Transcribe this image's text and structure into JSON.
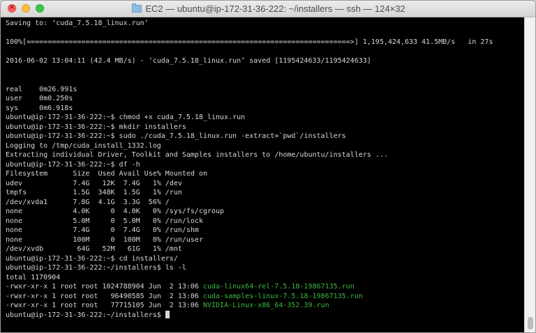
{
  "window": {
    "title": "EC2 — ubuntu@ip-172-31-36-222: ~/installers — ssh — 124×32",
    "close_glyph": "×"
  },
  "terminal": {
    "lines": [
      {
        "text": "Saving to: ‘cuda_7.5.18_linux.run’"
      },
      {
        "text": ""
      },
      {
        "text": "100%[=============================================================================>] 1,195,424,633 41.5MB/s   in 27s"
      },
      {
        "text": ""
      },
      {
        "text": "2016-06-02 13:04:11 (42.4 MB/s) - ‘cuda_7.5.18_linux.run’ saved [1195424633/1195424633]"
      },
      {
        "text": ""
      },
      {
        "text": ""
      },
      {
        "text": "real\t0m26.991s"
      },
      {
        "text": "user\t0m0.250s"
      },
      {
        "text": "sys\t0m6.918s"
      },
      {
        "text": "ubuntu@ip-172-31-36-222:~$ chmod +x cuda_7.5.18_linux.run"
      },
      {
        "text": "ubuntu@ip-172-31-36-222:~$ mkdir installers"
      },
      {
        "text": "ubuntu@ip-172-31-36-222:~$ sudo ./cuda_7.5.18_linux.run -extract=`pwd`/installers"
      },
      {
        "text": "Logging to /tmp/cuda_install_1332.log"
      },
      {
        "text": "Extracting individual Driver, Toolkit and Samples installers to /home/ubuntu/installers ..."
      },
      {
        "text": "ubuntu@ip-172-31-36-222:~$ df -h"
      },
      {
        "text": "Filesystem      Size  Used Avail Use% Mounted on"
      },
      {
        "text": "udev            7.4G   12K  7.4G   1% /dev"
      },
      {
        "text": "tmpfs           1.5G  348K  1.5G   1% /run"
      },
      {
        "text": "/dev/xvda1      7.8G  4.1G  3.3G  56% /"
      },
      {
        "text": "none            4.0K     0  4.0K   0% /sys/fs/cgroup"
      },
      {
        "text": "none            5.0M     0  5.0M   0% /run/lock"
      },
      {
        "text": "none            7.4G     0  7.4G   0% /run/shm"
      },
      {
        "text": "none            100M     0  100M   0% /run/user"
      },
      {
        "text": "/dev/xvdb        64G   52M   61G   1% /mnt"
      },
      {
        "text": "ubuntu@ip-172-31-36-222:~$ cd installers/"
      },
      {
        "text": "ubuntu@ip-172-31-36-222:~/installers$ ls -l"
      },
      {
        "text": "total 1170904"
      },
      {
        "text": "-rwxr-xr-x 1 root root 1024788904 Jun  2 13:06 ",
        "exec": "cuda-linux64-rel-7.5.18-19867135.run"
      },
      {
        "text": "-rwxr-xr-x 1 root root   96490585 Jun  2 13:06 ",
        "exec": "cuda-samples-linux-7.5.18-19867135.run"
      },
      {
        "text": "-rwxr-xr-x 1 root root   77715105 Jun  2 13:06 ",
        "exec": "NVIDIA-Linux-x86_64-352.39.run"
      },
      {
        "text": "ubuntu@ip-172-31-36-222:~/installers$ ",
        "cursor": true
      }
    ]
  },
  "colors": {
    "text": "#d8d8d8",
    "executable": "#3cb840",
    "background": "#000000"
  }
}
